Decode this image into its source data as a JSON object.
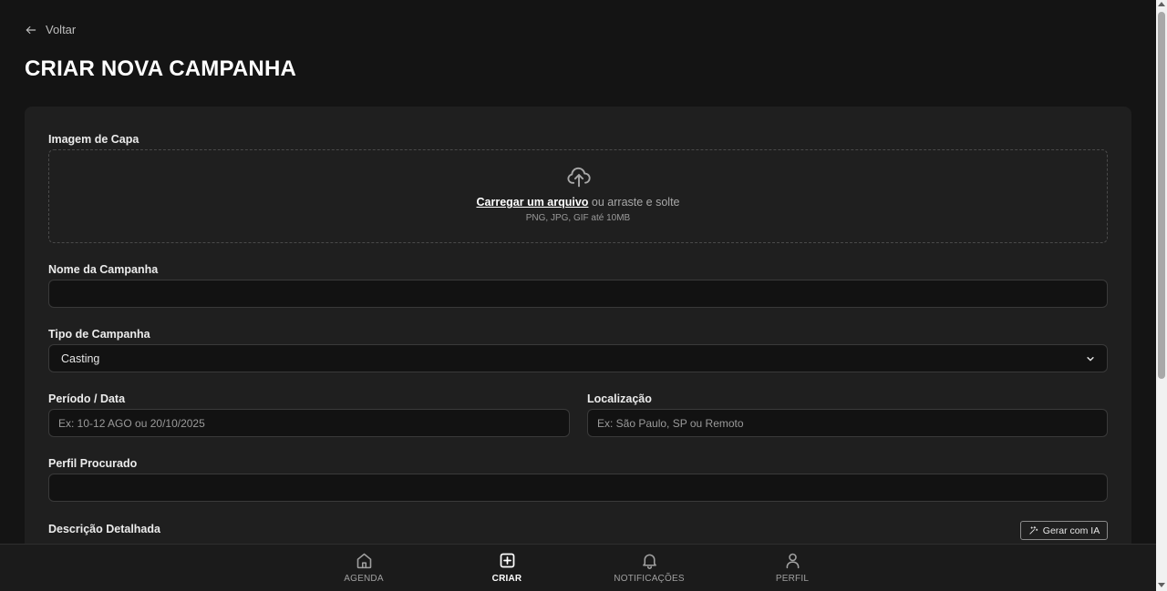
{
  "header": {
    "back_label": "Voltar",
    "title": "CRIAR NOVA CAMPANHA"
  },
  "form": {
    "cover": {
      "label": "Imagem de Capa",
      "upload_link": "Carregar um arquivo",
      "upload_suffix": " ou arraste e solte",
      "hint": "PNG, JPG, GIF até 10MB"
    },
    "name": {
      "label": "Nome da Campanha",
      "value": "",
      "placeholder": ""
    },
    "type": {
      "label": "Tipo de Campanha",
      "selected": "Casting"
    },
    "period": {
      "label": "Período / Data",
      "value": "",
      "placeholder": "Ex: 10-12 AGO ou 20/10/2025"
    },
    "location": {
      "label": "Localização",
      "value": "",
      "placeholder": "Ex: São Paulo, SP ou Remoto"
    },
    "profile": {
      "label": "Perfil Procurado",
      "value": "",
      "placeholder": ""
    },
    "description": {
      "label": "Descrição Detalhada",
      "ai_button": "Gerar com IA"
    }
  },
  "nav": {
    "items": [
      {
        "label": "AGENDA",
        "icon": "home-icon",
        "active": false
      },
      {
        "label": "CRIAR",
        "icon": "plus-square-icon",
        "active": true
      },
      {
        "label": "NOTIFICAÇÕES",
        "icon": "bell-icon",
        "active": false
      },
      {
        "label": "PERFIL",
        "icon": "user-icon",
        "active": false
      }
    ]
  },
  "colors": {
    "background": "#141414",
    "card": "#1f1f1f",
    "input": "#121212",
    "border": "#3a3a3a",
    "text": "#e6e6e6",
    "muted": "#a0a0a0"
  }
}
